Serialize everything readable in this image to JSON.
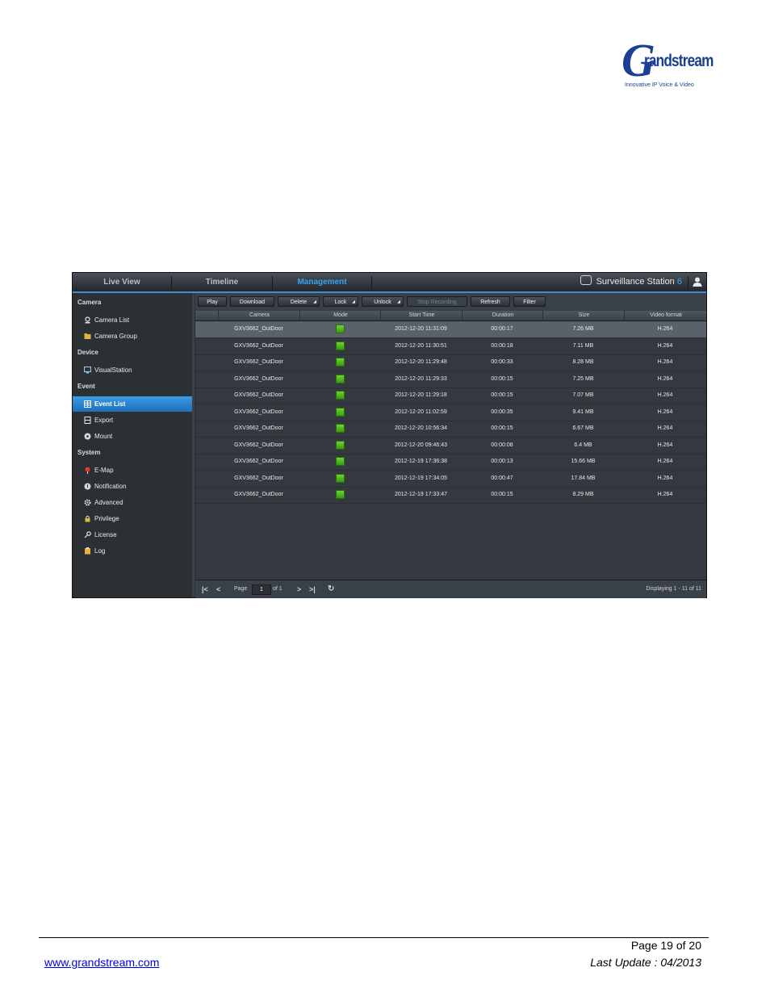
{
  "logo": {
    "letter": "G",
    "rest": "randstream",
    "tagline": "Innovative IP Voice & Video"
  },
  "app": {
    "nav": [
      "Live View",
      "Timeline",
      "Management"
    ],
    "brand": {
      "text": "Surveillance Station",
      "version": "6"
    },
    "sidebar": {
      "sections": [
        "Camera",
        "Device",
        "Event",
        "System"
      ],
      "items": [
        "Camera List",
        "Camera Group",
        "VisualStation",
        "Event List",
        "Export",
        "Mount",
        "E-Map",
        "Notification",
        "Advanced",
        "Privilege",
        "License",
        "Log"
      ]
    },
    "toolbar": [
      "Play",
      "Download",
      "Delete",
      "Lock",
      "Unlock",
      "Stop Recording",
      "Refresh",
      "Filter"
    ],
    "columns": [
      "Camera",
      "Mode",
      "Start Time",
      "Duration",
      "Size",
      "Video format"
    ],
    "rows": [
      [
        "GXV3662_OutDoor",
        "2012-12-20 11:31:09",
        "00:00:17",
        "7.26 MB",
        "H.264"
      ],
      [
        "GXV3662_OutDoor",
        "2012-12-20 11:30:51",
        "00:00:18",
        "7.11 MB",
        "H.264"
      ],
      [
        "GXV3662_OutDoor",
        "2012-12-20 11:29:48",
        "00:00:33",
        "8.28 MB",
        "H.264"
      ],
      [
        "GXV3662_OutDoor",
        "2012-12-20 11:29:33",
        "00:00:15",
        "7.25 MB",
        "H.264"
      ],
      [
        "GXV3662_OutDoor",
        "2012-12-20 11:29:18",
        "00:00:15",
        "7.07 MB",
        "H.264"
      ],
      [
        "GXV3662_OutDoor",
        "2012-12-20 11:02:59",
        "00:00:35",
        "9.41 MB",
        "H.264"
      ],
      [
        "GXV3662_OutDoor",
        "2012-12-20 10:56:34",
        "00:00:15",
        "6.67 MB",
        "H.264"
      ],
      [
        "GXV3662_OutDoor",
        "2012-12-20 09:46:43",
        "00:00:08",
        "6.4 MB",
        "H.264"
      ],
      [
        "GXV3662_OutDoor",
        "2012-12-19 17:36:38",
        "00:00:13",
        "15.66 MB",
        "H.264"
      ],
      [
        "GXV3662_OutDoor",
        "2012-12-19 17:34:05",
        "00:00:47",
        "17.84 MB",
        "H.264"
      ],
      [
        "GXV3662_OutDoor",
        "2012-12-19 17:33:47",
        "00:00:15",
        "8.29 MB",
        "H.264"
      ]
    ],
    "pager": {
      "page_label": "Page",
      "page_value": "1",
      "of_label": "of 1",
      "displaying": "Displaying 1 - 11 of 11"
    }
  },
  "footer": {
    "page": "Page 19 of 20",
    "site": "www.grandstream.com",
    "update": "Last Update : 04/2013"
  }
}
